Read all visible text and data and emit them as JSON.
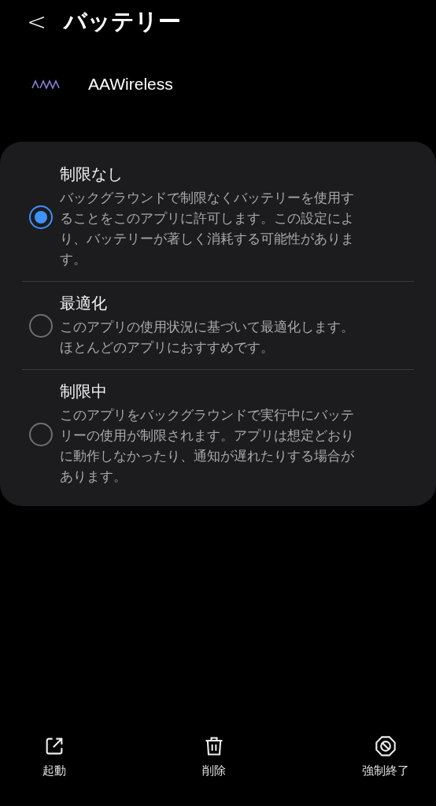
{
  "header": {
    "back": "<",
    "title": "バッテリー"
  },
  "app": {
    "name": "AAWireless"
  },
  "options": [
    {
      "title": "制限なし",
      "description": "バックグラウンドで制限なくバッテリーを使用することをこのアプリに許可します。この設定により、バッテリーが著しく消耗する可能性があります。",
      "selected": true
    },
    {
      "title": "最適化",
      "description": "このアプリの使用状況に基づいて最適化します。ほとんどのアプリにおすすめです。",
      "selected": false
    },
    {
      "title": "制限中",
      "description": "このアプリをバックグラウンドで実行中にバッテリーの使用が制限されます。アプリは想定どおりに動作しなかったり、通知が遅れたりする場合があります。",
      "selected": false
    }
  ],
  "actions": [
    {
      "kind": "open",
      "label": "起動"
    },
    {
      "kind": "delete",
      "label": "削除"
    },
    {
      "kind": "stop",
      "label": "強制終了"
    }
  ]
}
